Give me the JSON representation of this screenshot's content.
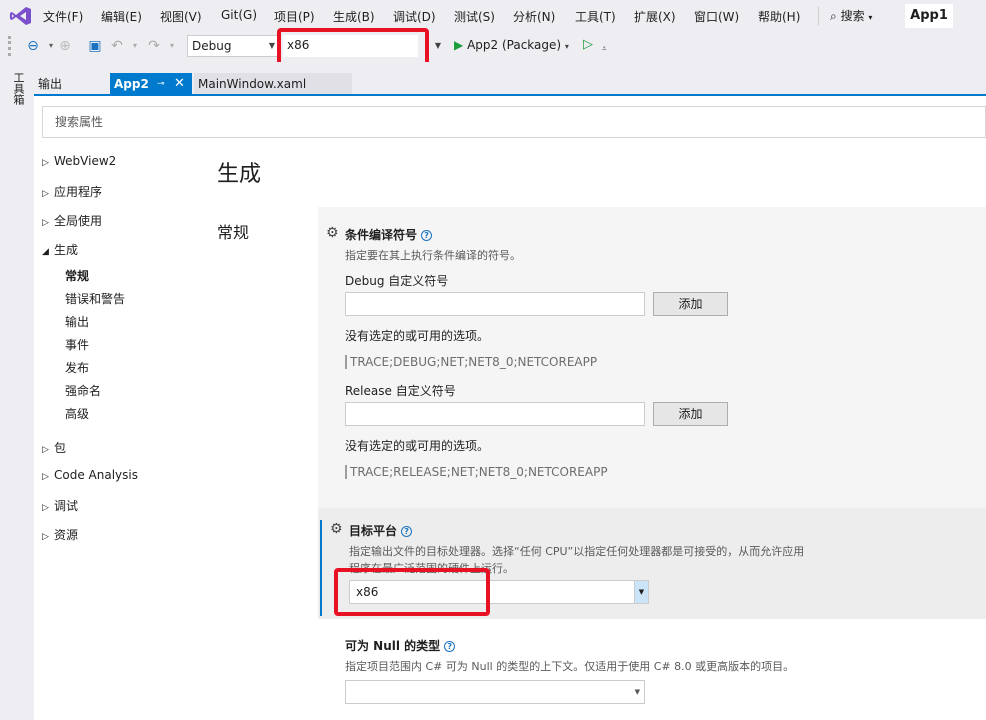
{
  "menu": [
    "文件(F)",
    "编辑(E)",
    "视图(V)",
    "Git(G)",
    "项目(P)",
    "生成(B)",
    "调试(D)",
    "测试(S)",
    "分析(N)",
    "工具(T)",
    "扩展(X)",
    "窗口(W)",
    "帮助(H)"
  ],
  "search_label": "搜索",
  "app_title": "App1",
  "toolbar": {
    "config": "Debug",
    "platform": "x86",
    "run_target": "App2 (Package)"
  },
  "toolbox_label": "工具箱",
  "tabs": [
    {
      "label": "输出"
    },
    {
      "label": "App2"
    },
    {
      "label": "MainWindow.xaml"
    }
  ],
  "search_placeholder": "搜索属性",
  "nav": {
    "items_top": [
      "WebView2",
      "应用程序",
      "全局使用"
    ],
    "expanded": "生成",
    "sub_items": [
      "常规",
      "错误和警告",
      "输出",
      "事件",
      "发布",
      "强命名",
      "高级"
    ],
    "items_bottom": [
      "包",
      "Code Analysis",
      "调试",
      "资源"
    ]
  },
  "page": {
    "title": "生成",
    "section": "常规"
  },
  "settings": {
    "conditional": {
      "title": "条件编译符号",
      "desc": "指定要在其上执行条件编译的符号。",
      "debug_label": "Debug 自定义符号",
      "release_label": "Release 自定义符号",
      "add_label": "添加",
      "no_options": "没有选定的或可用的选项。",
      "debug_symbols": "TRACE;DEBUG;NET;NET8_0;NETCOREAPP",
      "release_symbols": "TRACE;RELEASE;NET;NET8_0;NETCOREAPP"
    },
    "platform": {
      "title": "目标平台",
      "desc_line1": "指定输出文件的目标处理器。选择“任何 CPU”以指定任何处理器都是可接受的，从而允许应用",
      "desc_line2": "程序在最广泛范围的硬件上运行。",
      "value": "x86"
    },
    "nullable": {
      "title": "可为 Null 的类型",
      "desc": "指定项目范围内 C# 可为 Null 的类型的上下文。仅适用于使用 C# 8.0 或更高版本的项目。",
      "value": ""
    }
  },
  "colors": {
    "accent": "#007acc",
    "highlight": "#e81123",
    "vs_logo": "#68217a"
  }
}
